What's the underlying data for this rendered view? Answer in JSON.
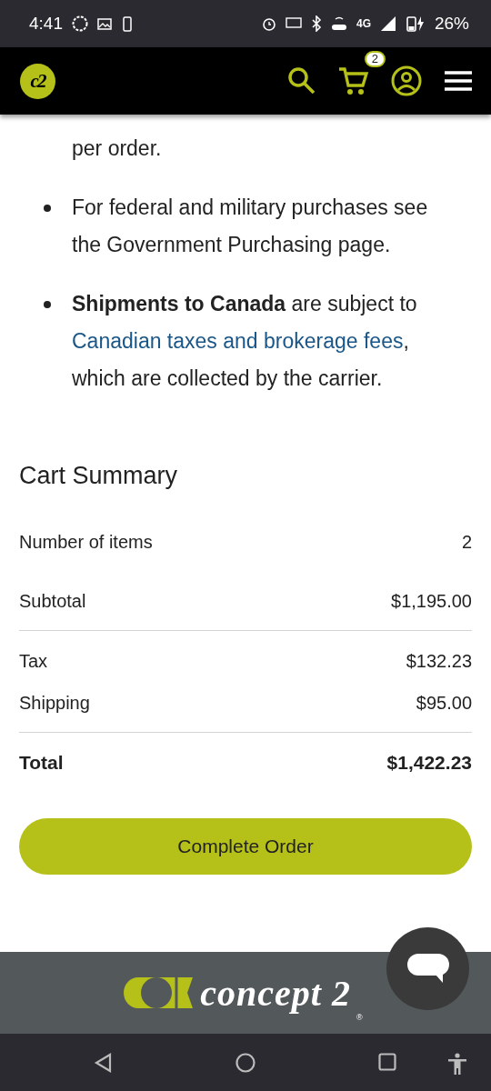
{
  "status_bar": {
    "time": "4:41",
    "network": "4G",
    "battery": "26%"
  },
  "header": {
    "logo": "c2",
    "cart_count": "2"
  },
  "notes": [
    {
      "kind": "continuation",
      "text": "per order."
    },
    {
      "kind": "bullet",
      "text": "For federal and military purchases see the Government Purchasing page."
    },
    {
      "kind": "bullet",
      "text": "**Shipments to Canada** are subject to",
      "link": "Canadian taxes and brokerage fees",
      "tail": ", which are collected by the carrier."
    }
  ],
  "cart_summary": {
    "title": "Cart Summary",
    "rows": [
      {
        "kind": "line",
        "label": "Number of items",
        "value": "2",
        "divider": false
      },
      {
        "kind": "line",
        "label": "Subtotal",
        "value": "$1,195.00",
        "divider": true
      },
      {
        "kind": "line",
        "label": "Tax",
        "value": "$132.23",
        "divider": false
      },
      {
        "kind": "line",
        "label": "Shipping",
        "value": "$95.00",
        "divider": true
      },
      {
        "kind": "total",
        "label": "Total",
        "value": "$1,422.23",
        "divider": false
      }
    ],
    "button": "Complete Order"
  },
  "footer": {
    "logo": "concept 2",
    "mark": "®"
  }
}
